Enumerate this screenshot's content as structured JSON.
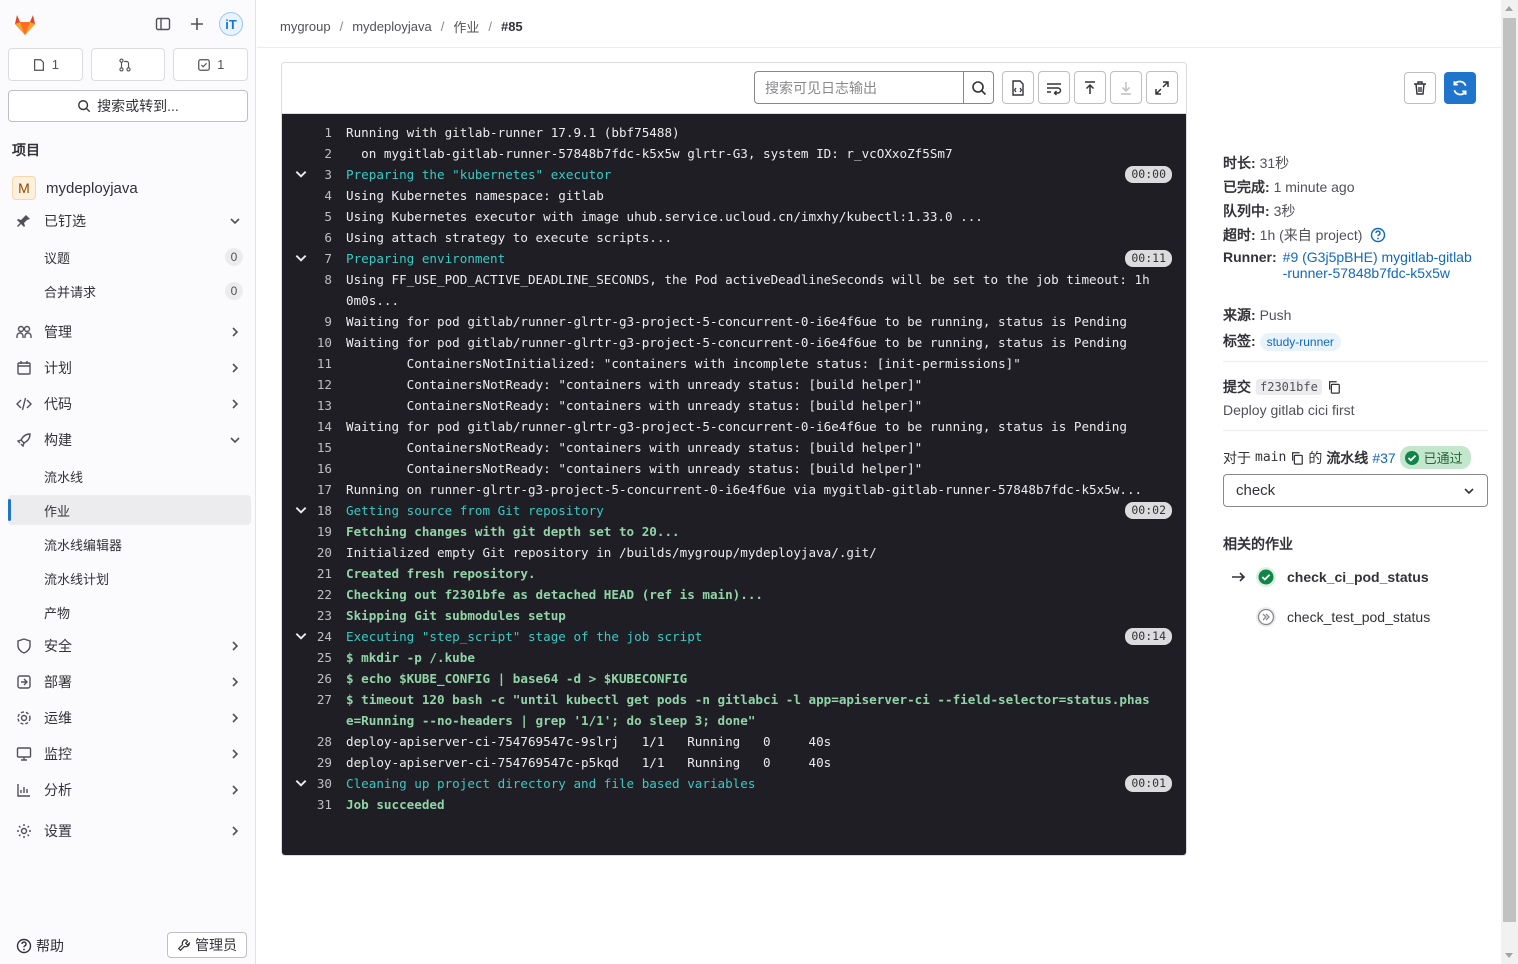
{
  "sidebar": {
    "counters": {
      "issues": "1",
      "merge_requests": "",
      "todos": "1"
    },
    "search_label": "搜索或转到...",
    "section_heading": "项目",
    "project_initial": "M",
    "project_name": "mydeployjava",
    "pinned": {
      "label": "已钉选",
      "items": [
        {
          "label": "议题",
          "count": "0"
        },
        {
          "label": "合并请求",
          "count": "0"
        }
      ]
    },
    "nav": {
      "manage": "管理",
      "plan": "计划",
      "code": "代码",
      "build": "构建",
      "build_items": [
        "流水线",
        "作业",
        "流水线编辑器",
        "流水线计划",
        "产物"
      ],
      "secure": "安全",
      "deploy": "部署",
      "operate": "运维",
      "monitor": "监控",
      "analyze": "分析",
      "settings": "设置"
    },
    "help": "帮助",
    "admin": "管理员"
  },
  "breadcrumb": [
    "mygroup",
    "mydeployjava",
    "作业",
    "#85"
  ],
  "log": {
    "search_placeholder": "搜索可见日志输出",
    "lines": [
      {
        "n": "1",
        "t": "Running with gitlab-runner 17.9.1 (bbf75488)",
        "k": ""
      },
      {
        "n": "2",
        "t": "  on mygitlab-gitlab-runner-57848b7fdc-k5x5w glrtr-G3, system ID: r_vcOXxoZf5Sm7",
        "k": ""
      },
      {
        "n": "3",
        "t": "Preparing the \"kubernetes\" executor",
        "k": "section",
        "d": "00:00"
      },
      {
        "n": "4",
        "t": "Using Kubernetes namespace: gitlab",
        "k": ""
      },
      {
        "n": "5",
        "t": "Using Kubernetes executor with image uhub.service.ucloud.cn/imxhy/kubectl:1.33.0 ...",
        "k": ""
      },
      {
        "n": "6",
        "t": "Using attach strategy to execute scripts...",
        "k": ""
      },
      {
        "n": "7",
        "t": "Preparing environment",
        "k": "section",
        "d": "00:11"
      },
      {
        "n": "8",
        "t": "Using FF_USE_POD_ACTIVE_DEADLINE_SECONDS, the Pod activeDeadlineSeconds will be set to the job timeout: 1h0m0s...",
        "k": ""
      },
      {
        "n": "9",
        "t": "Waiting for pod gitlab/runner-glrtr-g3-project-5-concurrent-0-i6e4f6ue to be running, status is Pending",
        "k": ""
      },
      {
        "n": "10",
        "t": "Waiting for pod gitlab/runner-glrtr-g3-project-5-concurrent-0-i6e4f6ue to be running, status is Pending",
        "k": ""
      },
      {
        "n": "11",
        "t": "        ContainersNotInitialized: \"containers with incomplete status: [init-permissions]\"",
        "k": ""
      },
      {
        "n": "12",
        "t": "        ContainersNotReady: \"containers with unready status: [build helper]\"",
        "k": ""
      },
      {
        "n": "13",
        "t": "        ContainersNotReady: \"containers with unready status: [build helper]\"",
        "k": ""
      },
      {
        "n": "14",
        "t": "Waiting for pod gitlab/runner-glrtr-g3-project-5-concurrent-0-i6e4f6ue to be running, status is Pending",
        "k": ""
      },
      {
        "n": "15",
        "t": "        ContainersNotReady: \"containers with unready status: [build helper]\"",
        "k": ""
      },
      {
        "n": "16",
        "t": "        ContainersNotReady: \"containers with unready status: [build helper]\"",
        "k": ""
      },
      {
        "n": "17",
        "t": "Running on runner-glrtr-g3-project-5-concurrent-0-i6e4f6ue via mygitlab-gitlab-runner-57848b7fdc-k5x5w...",
        "k": ""
      },
      {
        "n": "18",
        "t": "Getting source from Git repository",
        "k": "section",
        "d": "00:02"
      },
      {
        "n": "19",
        "t": "Fetching changes with git depth set to 20...",
        "k": "green"
      },
      {
        "n": "20",
        "t": "Initialized empty Git repository in /builds/mygroup/mydeployjava/.git/",
        "k": ""
      },
      {
        "n": "21",
        "t": "Created fresh repository.",
        "k": "green"
      },
      {
        "n": "22",
        "t": "Checking out f2301bfe as detached HEAD (ref is main)...",
        "k": "green"
      },
      {
        "n": "23",
        "t": "Skipping Git submodules setup",
        "k": "green"
      },
      {
        "n": "24",
        "t": "Executing \"step_script\" stage of the job script",
        "k": "section",
        "d": "00:14"
      },
      {
        "n": "25",
        "t": "$ mkdir -p /.kube",
        "k": "green"
      },
      {
        "n": "26",
        "t": "$ echo $KUBE_CONFIG | base64 -d > $KUBECONFIG",
        "k": "green"
      },
      {
        "n": "27",
        "t": "$ timeout 120 bash -c \"until kubectl get pods -n gitlabci -l app=apiserver-ci --field-selector=status.phase=Running --no-headers | grep '1/1'; do sleep 3; done\"",
        "k": "green"
      },
      {
        "n": "28",
        "t": "deploy-apiserver-ci-754769547c-9slrj   1/1   Running   0     40s",
        "k": ""
      },
      {
        "n": "29",
        "t": "deploy-apiserver-ci-754769547c-p5kqd   1/1   Running   0     40s",
        "k": ""
      },
      {
        "n": "30",
        "t": "Cleaning up project directory and file based variables",
        "k": "section",
        "d": "00:01"
      },
      {
        "n": "31",
        "t": "Job succeeded",
        "k": "green"
      }
    ]
  },
  "panel": {
    "duration_label": "时长:",
    "duration": "31秒",
    "finished_label": "已完成:",
    "finished": "1 minute ago",
    "queued_label": "队列中:",
    "queued": "3秒",
    "timeout_label": "超时:",
    "timeout": "1h (来自 project)",
    "runner_label": "Runner:",
    "runner_link": "#9 (G3j5pBHE) mygitlab-gitlab-runner-57848b7fdc-k5x5w",
    "source_label": "来源:",
    "source": "Push",
    "tags_label": "标签:",
    "tag": "study-runner",
    "commit_label": "提交",
    "commit_sha": "f2301bfe",
    "commit_message": "Deploy gitlab cici first",
    "pipeline_for": "对于",
    "branch": "main",
    "pipeline_of": "的",
    "pipeline_label": "流水线",
    "pipeline_id": "#37",
    "pipeline_status": "已通过",
    "stage_selected": "check",
    "related_title": "相关的作业",
    "related_jobs": [
      "check_ci_pod_status",
      "check_test_pod_status"
    ]
  },
  "colors": {
    "accent": "#1f75cb",
    "log_bg": "#1f1e24",
    "section_cyan": "#3ac9c4",
    "success_green": "#108548"
  }
}
